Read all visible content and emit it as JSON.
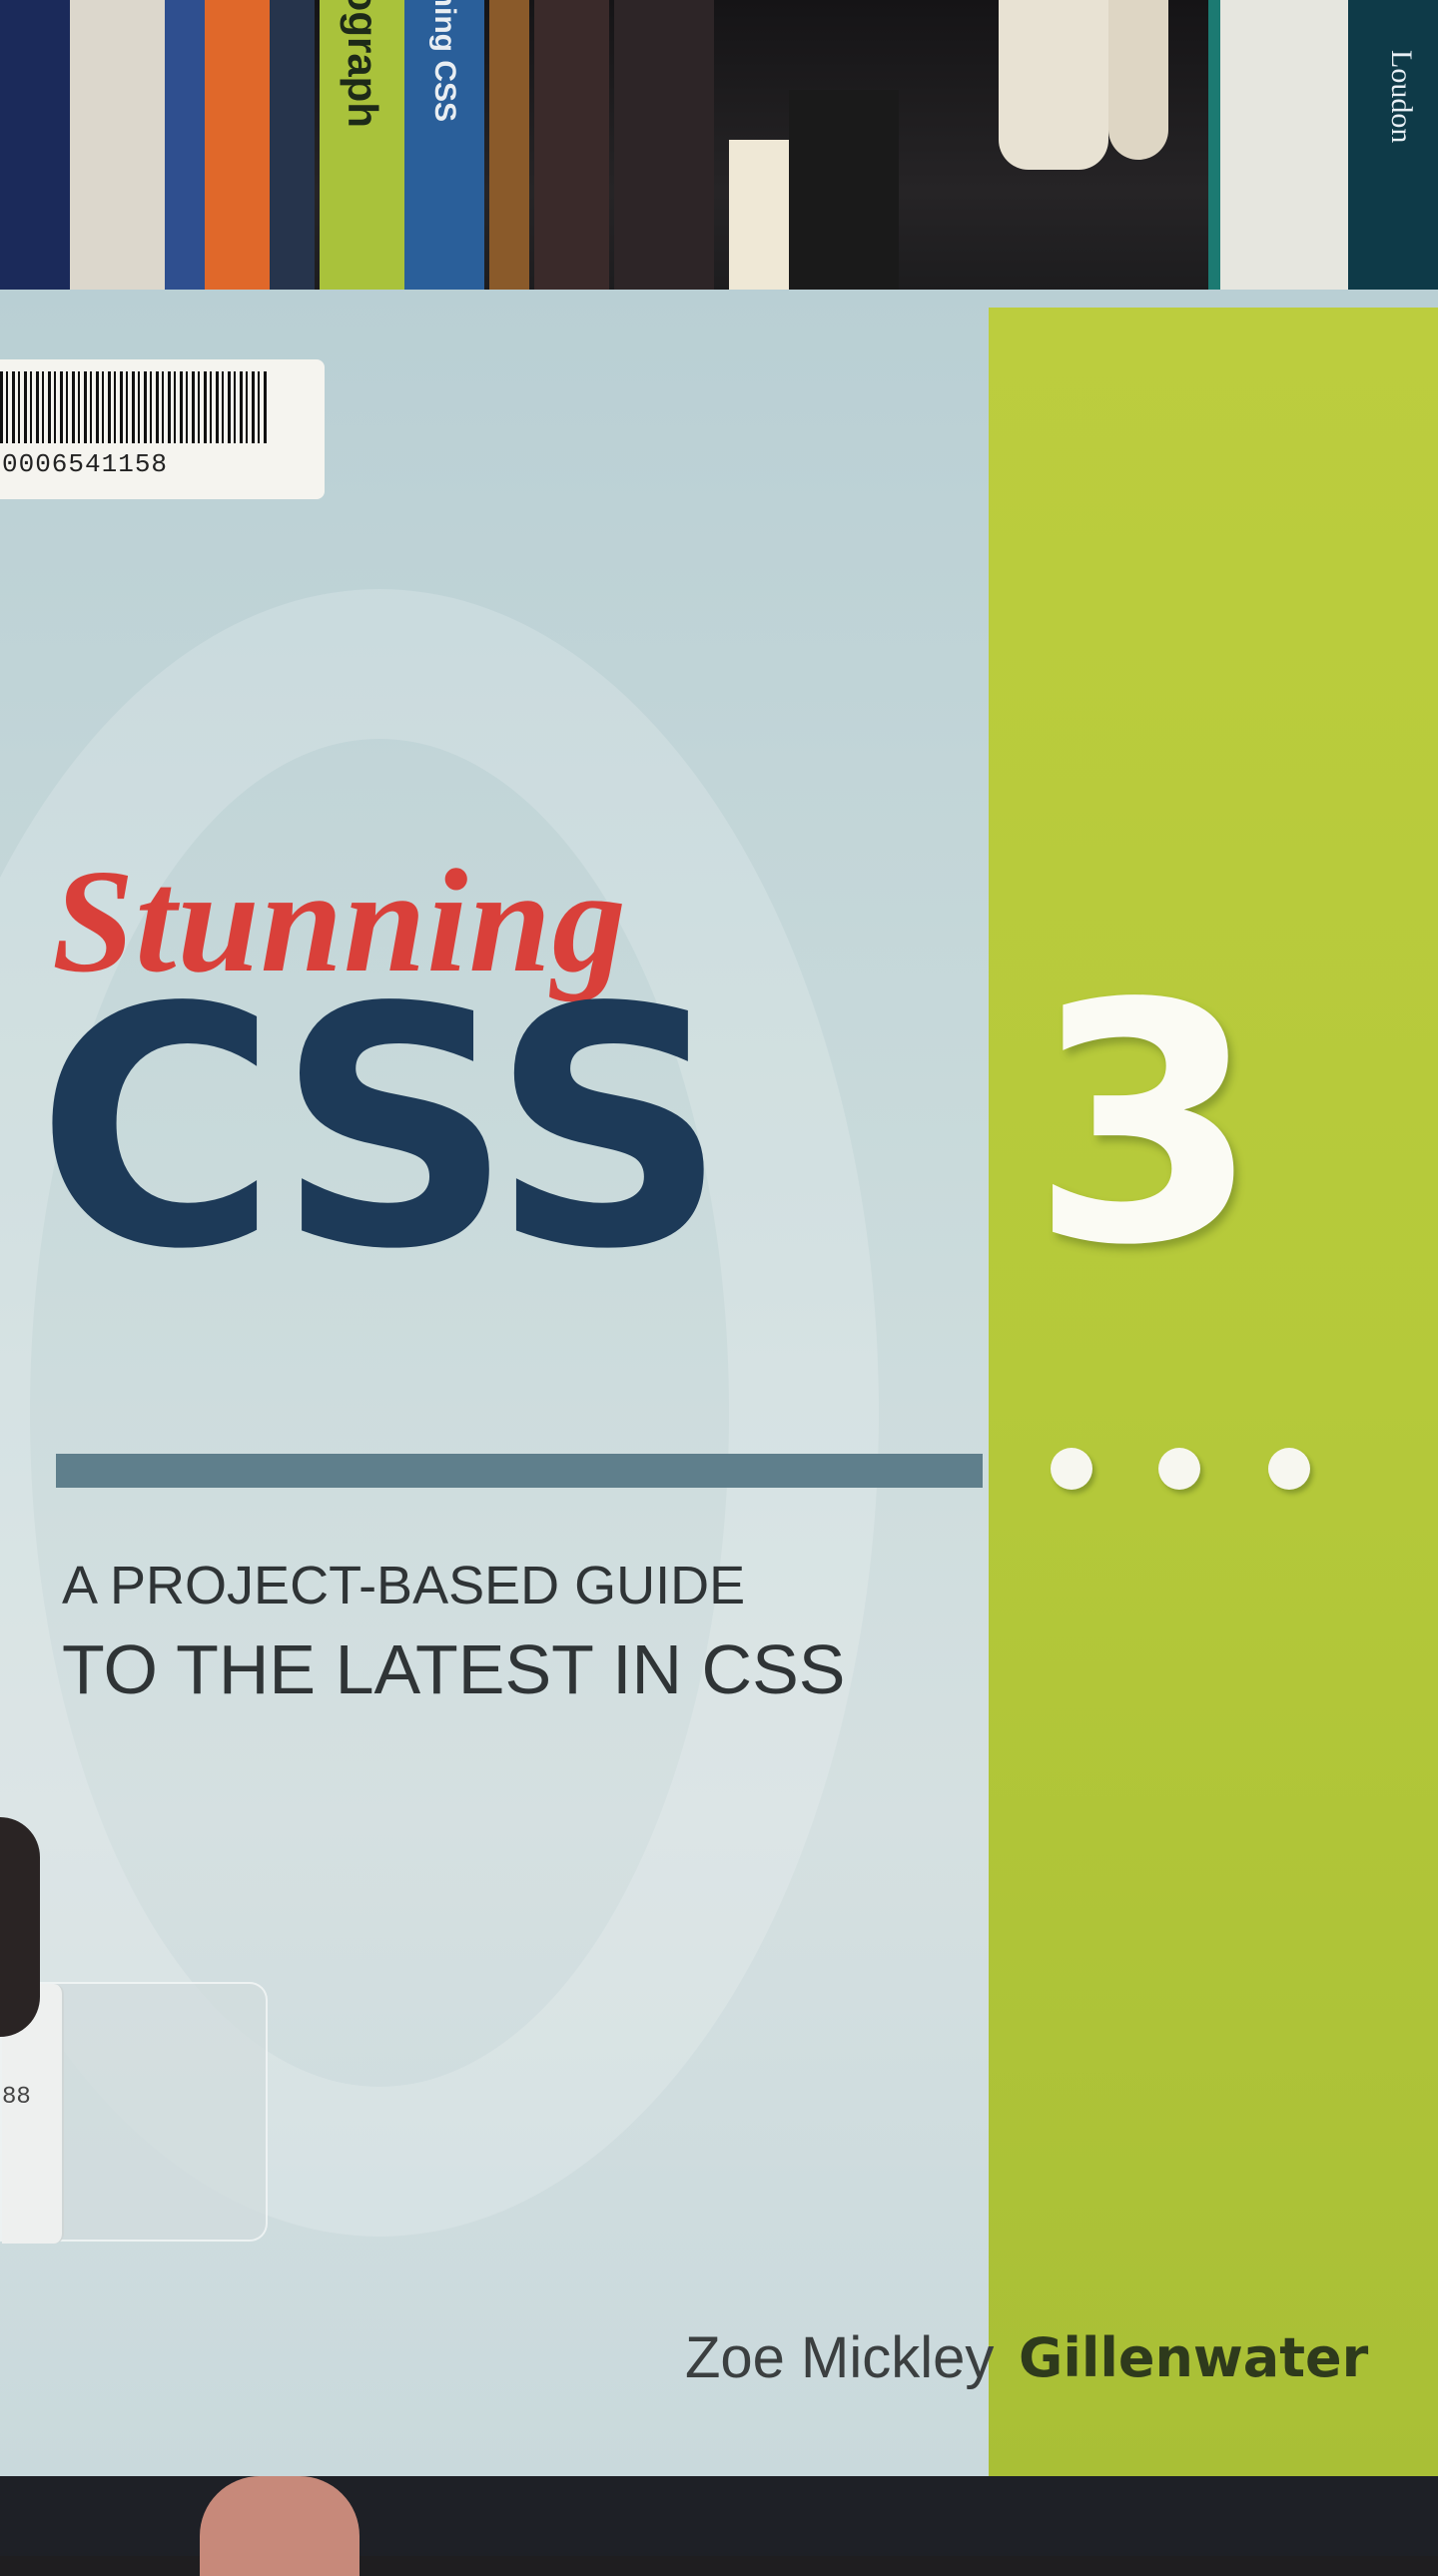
{
  "shelf": {
    "spines": [
      {
        "text": "",
        "color": "#1b2a5a"
      },
      {
        "text": "",
        "color": "#dcd7cc"
      },
      {
        "text": "",
        "color": "#e0682a"
      },
      {
        "text": "",
        "color": "#2f4f8f"
      },
      {
        "text": "pograph",
        "color": "#a9c23b"
      },
      {
        "text": "unning CSS",
        "color": "#2a5f9a"
      },
      {
        "text": "",
        "color": "#8a5a2a"
      },
      {
        "text": "",
        "color": "#3a2a2a"
      },
      {
        "text": "",
        "color": "#efe8d6"
      }
    ],
    "side_spine_text": "Loudon"
  },
  "cover": {
    "barcode_number": "0006541158",
    "sticker_number": "88",
    "title_word1": "Stunning",
    "title_main": "CSS",
    "title_number": "3",
    "subtitle_line1": "A PROJECT-BASED GUIDE",
    "subtitle_line2": "TO THE LATEST IN CSS",
    "author_first": "Zoe Mickley",
    "author_last": "Gillenwater",
    "colors": {
      "title_red": "#d9403a",
      "title_navy": "#1d3a58",
      "panel_green": "#b5c93a",
      "rule_slate": "#5f7f8c"
    }
  }
}
